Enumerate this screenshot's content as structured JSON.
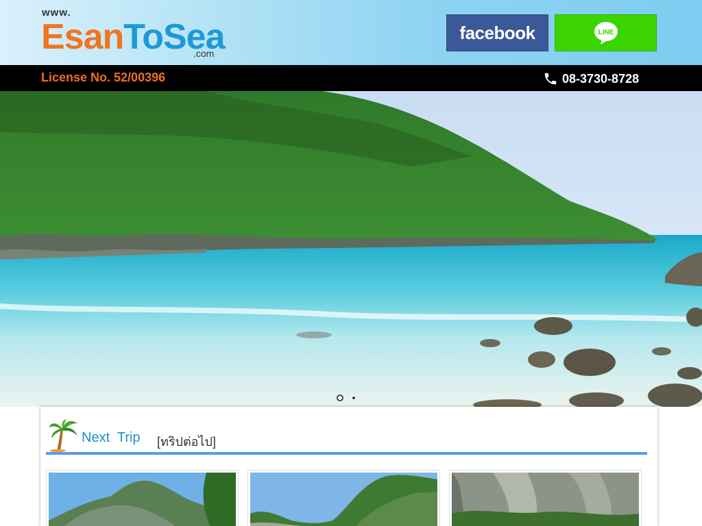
{
  "site": {
    "logo_www": "www.",
    "logo_esan": "Esan",
    "logo_tosea": "ToSea",
    "logo_com": ".com"
  },
  "social": {
    "facebook_label": "facebook",
    "line_label": "LINE"
  },
  "infobar": {
    "license": "License No. 52/00396",
    "phone": "08-3730-8728"
  },
  "slider": {
    "active_slide": 1,
    "slide_count": 2
  },
  "next_trip": {
    "title": "Next  Trip",
    "title_th": "[ทริปต่อไป]"
  },
  "colors": {
    "brand_orange": "#f27420",
    "brand_blue": "#1d9ad6",
    "facebook": "#3b5998",
    "line": "#3bd400",
    "accent_line": "#5b9bea"
  }
}
